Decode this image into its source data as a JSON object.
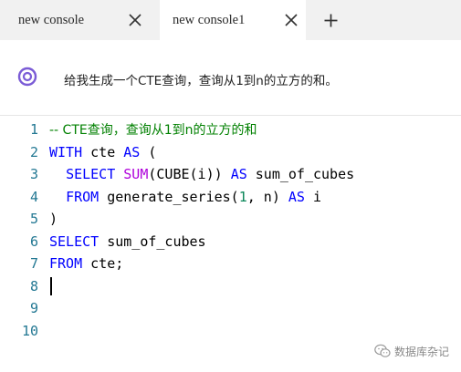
{
  "tabs": [
    {
      "label": "new console",
      "active": false
    },
    {
      "label": "new console1",
      "active": true
    }
  ],
  "icons": {
    "tab_close": "close-icon",
    "add_tab": "plus-icon",
    "prompt": "ai-assistant-icon",
    "watermark": "wechat-icon"
  },
  "prompt": {
    "text": "给我生成一个CTE查询，查询从1到n的立方的和。"
  },
  "editor": {
    "lines": [
      {
        "number": "1",
        "tokens": [
          {
            "t": "-- CTE查询，查询从1到n的立方的和",
            "c": "cm"
          }
        ]
      },
      {
        "number": "2",
        "tokens": [
          {
            "t": "WITH",
            "c": "kw"
          },
          {
            "t": " cte ",
            "c": "plain"
          },
          {
            "t": "AS",
            "c": "kw"
          },
          {
            "t": " (",
            "c": "plain"
          }
        ]
      },
      {
        "number": "3",
        "tokens": [
          {
            "t": "  ",
            "c": "plain"
          },
          {
            "t": "SELECT",
            "c": "kw"
          },
          {
            "t": " ",
            "c": "plain"
          },
          {
            "t": "SUM",
            "c": "fn"
          },
          {
            "t": "(CUBE(i)) ",
            "c": "plain"
          },
          {
            "t": "AS",
            "c": "kw"
          },
          {
            "t": " sum_of_cubes",
            "c": "plain"
          }
        ]
      },
      {
        "number": "4",
        "tokens": [
          {
            "t": "  ",
            "c": "plain"
          },
          {
            "t": "FROM",
            "c": "kw"
          },
          {
            "t": " generate_series(",
            "c": "plain"
          },
          {
            "t": "1",
            "c": "num"
          },
          {
            "t": ", n) ",
            "c": "plain"
          },
          {
            "t": "AS",
            "c": "kw"
          },
          {
            "t": " i",
            "c": "plain"
          }
        ]
      },
      {
        "number": "5",
        "tokens": [
          {
            "t": ")",
            "c": "plain"
          }
        ]
      },
      {
        "number": "6",
        "tokens": [
          {
            "t": "SELECT",
            "c": "kw"
          },
          {
            "t": " sum_of_cubes",
            "c": "plain"
          }
        ]
      },
      {
        "number": "7",
        "tokens": [
          {
            "t": "FROM",
            "c": "kw"
          },
          {
            "t": " cte;",
            "c": "plain"
          }
        ]
      },
      {
        "number": "8",
        "tokens": []
      },
      {
        "number": "9",
        "tokens": []
      },
      {
        "number": "10",
        "tokens": []
      }
    ],
    "cursor_line": "8"
  },
  "watermark": {
    "text": "数据库杂记"
  },
  "colors": {
    "keyword": "#0000ff",
    "function": "#af00db",
    "number": "#098658",
    "comment": "#008000",
    "line_number": "#237893",
    "prompt_icon": "#7b5cd6"
  }
}
